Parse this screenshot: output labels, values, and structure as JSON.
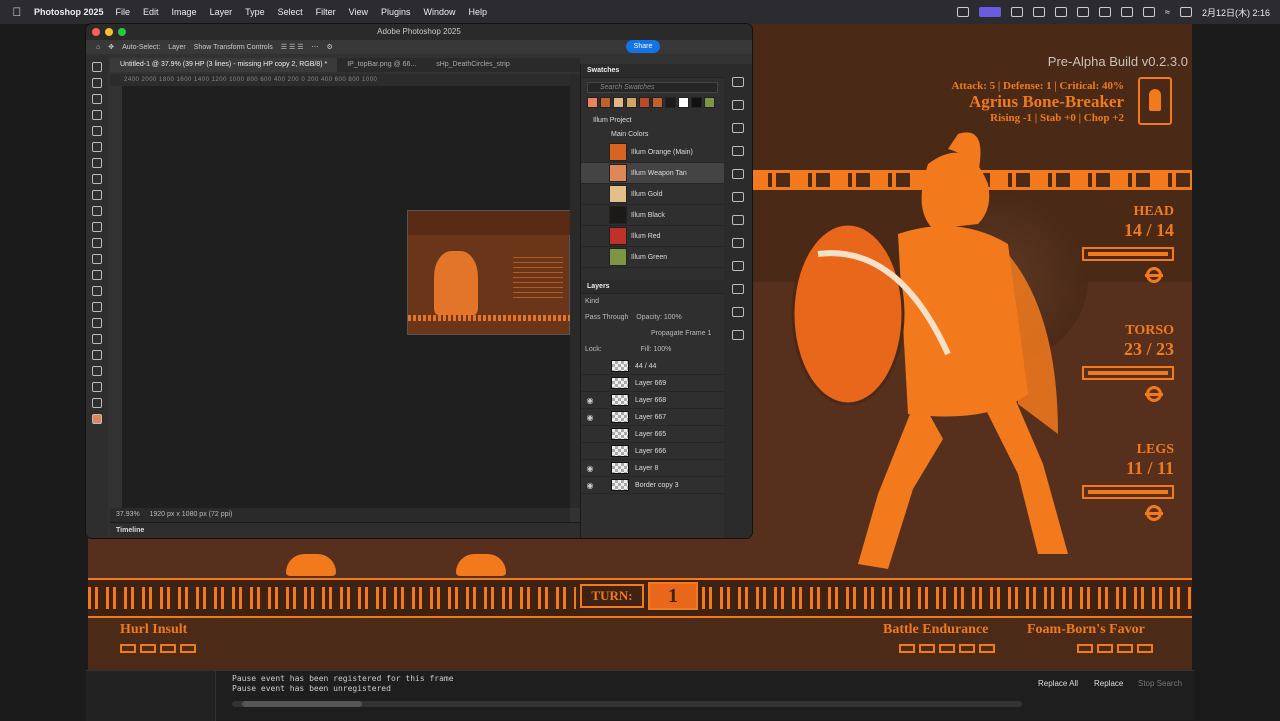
{
  "menubar": {
    "app": "Photoshop 2025",
    "items": [
      "File",
      "Edit",
      "Image",
      "Layer",
      "Type",
      "Select",
      "Filter",
      "View",
      "Plugins",
      "Window",
      "Help"
    ],
    "datetime": "2月12日(木) 2:16"
  },
  "game": {
    "build": "Pre-Alpha Build v0.2.3.0",
    "stats": "Attack: 5 | Defense: 1 | Critical: 40%",
    "hero_name": "Agrius Bone-Breaker",
    "moves": "Rising -1 | Stab +0 | Chop +2",
    "body_parts": [
      {
        "label": "HEAD",
        "value": "14 / 14"
      },
      {
        "label": "TORSO",
        "value": "23 / 23"
      },
      {
        "label": "LEGS",
        "value": "11 / 11"
      }
    ],
    "turn_label": "TURN:",
    "turn_value": "1",
    "abilities": [
      {
        "name": "Hurl Insult",
        "pips": 4
      },
      {
        "name": "Battle Endurance",
        "pips": 5
      },
      {
        "name": "Foam-Born's Favor",
        "pips": 4
      }
    ],
    "colors": {
      "accent": "#f27a1d",
      "background": "#4a2917"
    }
  },
  "console": {
    "lines": [
      "Pause event has been registered for this frame",
      "Pause event has been unregistered"
    ],
    "replace_all": "Replace All",
    "replace": "Replace",
    "stop_search": "Stop Search"
  },
  "photoshop": {
    "window_title": "Adobe Photoshop 2025",
    "auto_select": "Auto-Select:",
    "layer_select": "Layer",
    "transform": "Show Transform Controls",
    "share": "Share",
    "tabs": [
      "Untitled-1 @ 37.9% (39 HP (3 lines) - missing HP copy 2, RGB/8) *",
      "IP_topBar.png @ 66...",
      "sHp_DeathCircles_strip"
    ],
    "ruler": "2400  2000  1800  1600  1400  1200  1000   800   600   400   200    0    200   400   600   800  1000",
    "zoom": "37.93%",
    "doc_size": "1920 px x 1080 px (72 ppi)",
    "timeline": "Timeline",
    "swatches_title": "Swatches",
    "swatch_search": "Search Swatches",
    "chip_colors": [
      "#e8835a",
      "#c0612c",
      "#e0b783",
      "#d2a266",
      "#b94a2a",
      "#c0612c",
      "#1a1a1a",
      "#ffffff",
      "#111111",
      "#7e9645"
    ],
    "project": "Illum Project",
    "group": "Main Colors",
    "swatches": [
      {
        "name": "Illum Orange (Main)",
        "color": "#d8651f"
      },
      {
        "name": "Illum Weapon Tan",
        "color": "#e0875a"
      },
      {
        "name": "Illum Gold",
        "color": "#e3c08a"
      },
      {
        "name": "Illum Black",
        "color": "#1c1a19"
      },
      {
        "name": "Illum Red",
        "color": "#c0312a"
      },
      {
        "name": "Illum Green",
        "color": "#7c9646"
      }
    ],
    "layers_title": "Layers",
    "kind": "Kind",
    "blend": "Pass Through",
    "opacity_label": "Opacity:",
    "opacity": "100%",
    "lock_label": "Lock:",
    "fill_label": "Fill:",
    "fill": "100%",
    "propagate": "Propagate Frame 1",
    "layers": [
      {
        "name": "44 / 44",
        "visible": false
      },
      {
        "name": "Layer 669",
        "visible": false
      },
      {
        "name": "Layer 668",
        "visible": true
      },
      {
        "name": "Layer 667",
        "visible": true
      },
      {
        "name": "Layer 665",
        "visible": false
      },
      {
        "name": "Layer 666",
        "visible": false
      },
      {
        "name": "Layer 8",
        "visible": true
      },
      {
        "name": "Border copy 3",
        "visible": true
      }
    ]
  }
}
